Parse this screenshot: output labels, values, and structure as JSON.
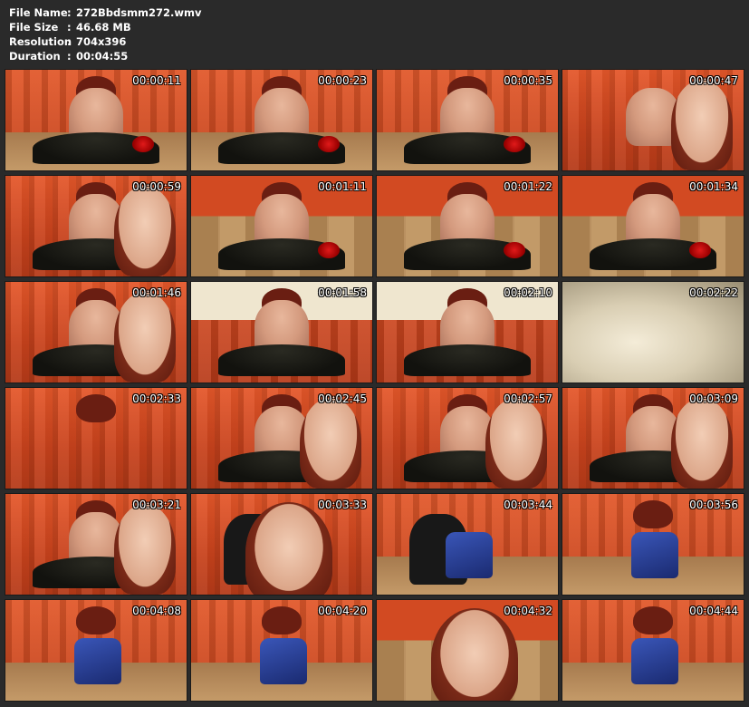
{
  "file_info": {
    "name_label": "File Name",
    "name_value": "272Bbdsmm272.wmv",
    "size_label": "File Size",
    "size_value": "46.68 MB",
    "resolution_label": "Resolution",
    "resolution_value": "704x396",
    "duration_label": "Duration",
    "duration_value": "00:04:55",
    "separator": ":"
  },
  "thumbnails": [
    {
      "time": "00:00:11",
      "scene": "floor"
    },
    {
      "time": "00:00:23",
      "scene": "floor"
    },
    {
      "time": "00:00:35",
      "scene": "floor"
    },
    {
      "time": "00:00:47",
      "scene": "face"
    },
    {
      "time": "00:00:59",
      "scene": "back-face"
    },
    {
      "time": "00:01:11",
      "scene": "wood"
    },
    {
      "time": "00:01:22",
      "scene": "wood"
    },
    {
      "time": "00:01:34",
      "scene": "wood"
    },
    {
      "time": "00:01:46",
      "scene": "back-face"
    },
    {
      "time": "00:01:58",
      "scene": "satin"
    },
    {
      "time": "00:02:10",
      "scene": "satin"
    },
    {
      "time": "00:02:22",
      "scene": "satin-full"
    },
    {
      "time": "00:02:33",
      "scene": "curtain"
    },
    {
      "time": "00:02:45",
      "scene": "back-face"
    },
    {
      "time": "00:02:57",
      "scene": "back-face"
    },
    {
      "time": "00:03:09",
      "scene": "back-face"
    },
    {
      "time": "00:03:21",
      "scene": "back-face"
    },
    {
      "time": "00:03:33",
      "scene": "dark-face"
    },
    {
      "time": "00:03:44",
      "scene": "dark-blue"
    },
    {
      "time": "00:03:56",
      "scene": "blue"
    },
    {
      "time": "00:04:08",
      "scene": "blue"
    },
    {
      "time": "00:04:20",
      "scene": "blue"
    },
    {
      "time": "00:04:32",
      "scene": "face-big"
    },
    {
      "time": "00:04:44",
      "scene": "blue"
    }
  ]
}
